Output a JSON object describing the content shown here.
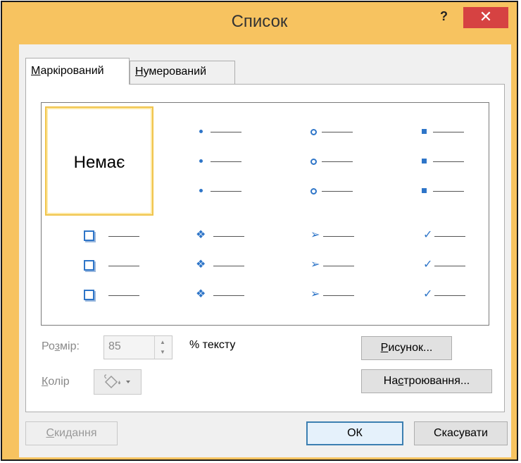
{
  "dialog": {
    "title": "Список",
    "help_label": "?",
    "close_label": "✕"
  },
  "tabs": [
    {
      "label_key": "М",
      "label_rest": "аркірований"
    },
    {
      "label_key": "Н",
      "label_rest": "умерований"
    }
  ],
  "gallery": {
    "none_label": "Немає",
    "bullet_icons": [
      "small-dot-icon",
      "hollow-circle-icon",
      "small-square-icon",
      "box-bullet-icon",
      "four-diamond-icon",
      "arrow-bullet-icon",
      "checkmark-icon"
    ],
    "accent_color": "#2e75c8",
    "selection_color": "#f0c44c"
  },
  "size": {
    "label_pre": "Ро",
    "label_key": "з",
    "label_post": "мір:",
    "value": "85",
    "unit_label": "% тексту"
  },
  "color": {
    "label_key": "К",
    "label_rest": "олір",
    "icon": "paint-bucket-icon"
  },
  "buttons": {
    "picture_key": "Р",
    "picture_rest": "исунок...",
    "customize_pre": "На",
    "customize_key": "с",
    "customize_post": "троювання...",
    "reset_key": "С",
    "reset_rest": "кидання",
    "ok_label": "ОК",
    "cancel_label": "Скасувати"
  }
}
